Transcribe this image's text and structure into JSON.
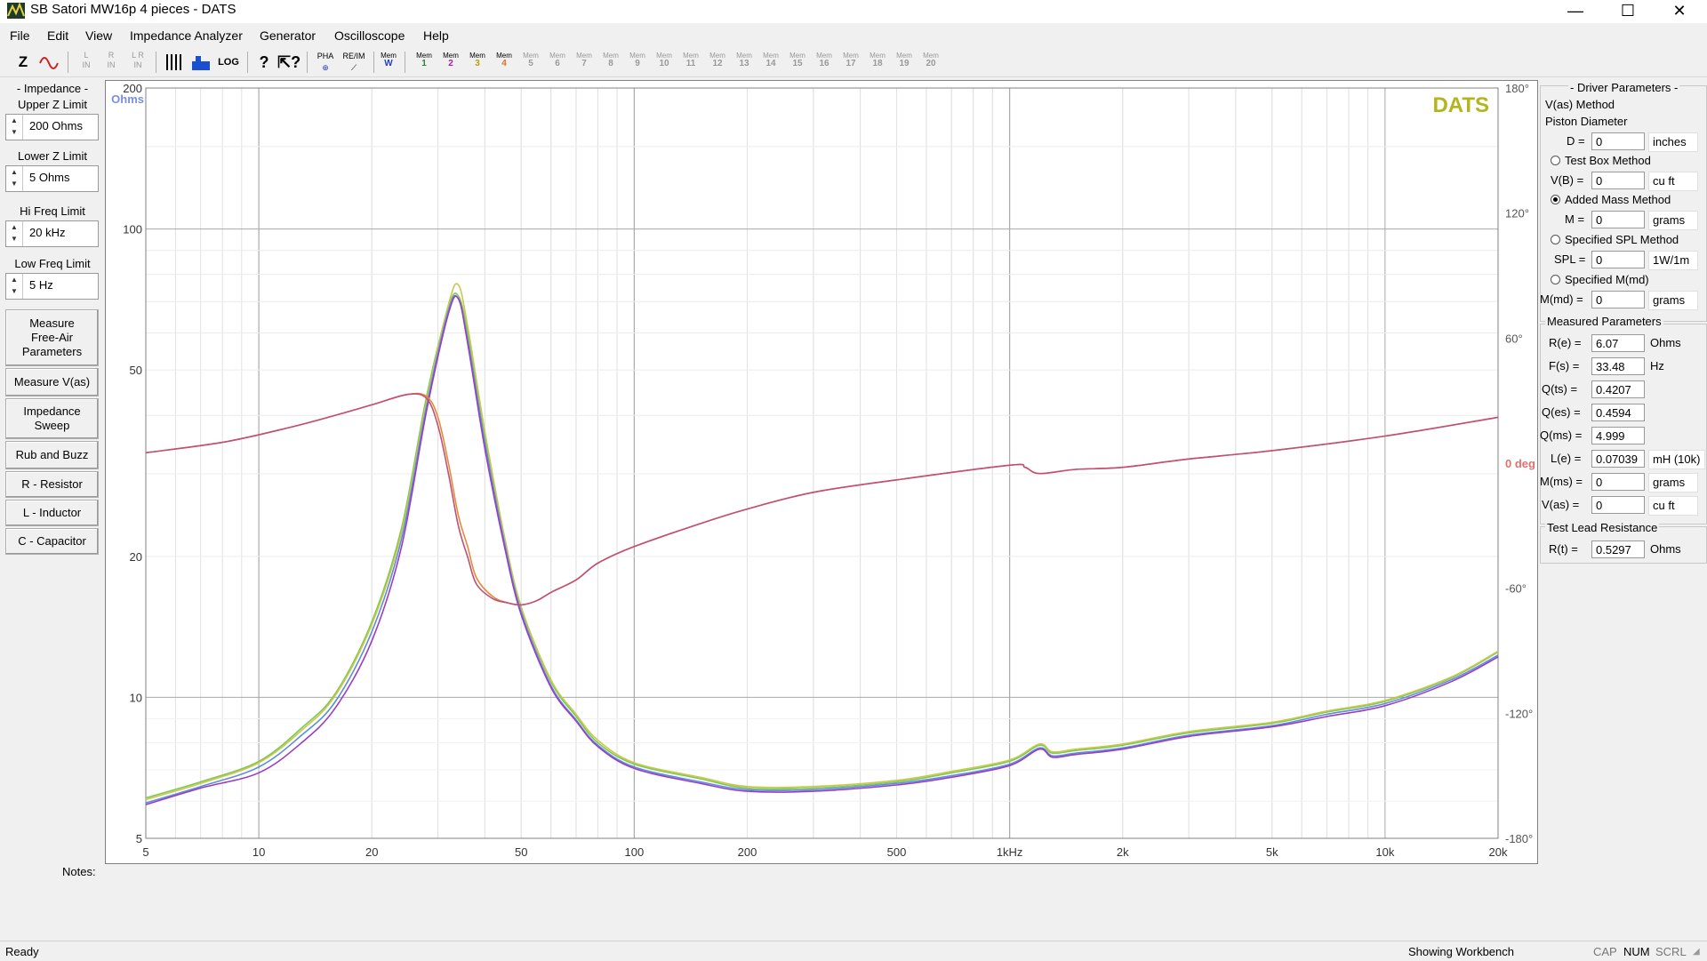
{
  "window": {
    "title": "SB Satori MW16p 4 pieces - DATS",
    "minimize": "—",
    "maximize": "☐",
    "close": "✕"
  },
  "menu": [
    "File",
    "Edit",
    "View",
    "Impedance Analyzer",
    "Generator",
    "Oscilloscope",
    "Help"
  ],
  "toolbar": {
    "z_label": "Z",
    "in_buttons": [
      {
        "a": "L",
        "b": "IN"
      },
      {
        "a": "R",
        "b": "IN"
      },
      {
        "a": "L R",
        "b": "IN"
      }
    ],
    "log_label": "LOG",
    "pha_label": "PHA",
    "reim_label": "RE/IM",
    "memw_label": "Mem",
    "memw_sub": "W",
    "mem_slots": [
      "1",
      "2",
      "3",
      "4",
      "5",
      "6",
      "7",
      "8",
      "9",
      "10",
      "11",
      "12",
      "13",
      "14",
      "15",
      "16",
      "17",
      "18",
      "19",
      "20"
    ],
    "mem_label": "Mem"
  },
  "left_panel": {
    "impedance_title": "- Impedance -",
    "upper_label": "Upper Z Limit",
    "upper_value": "200 Ohms",
    "lower_label": "Lower Z Limit",
    "lower_value": "5 Ohms",
    "hi_label": "Hi Freq Limit",
    "hi_value": "20 kHz",
    "low_label": "Low Freq Limit",
    "low_value": "5 Hz",
    "buttons": {
      "free_air": "Measure\nFree-Air\nParameters",
      "vas": "Measure V(as)",
      "sweep": "Impedance\nSweep",
      "rub": "Rub and Buzz",
      "r": "R - Resistor",
      "l": "L - Inductor",
      "c": "C - Capacitor"
    }
  },
  "plot": {
    "brand": "DATS",
    "unit_label": "Ohms",
    "left_ticks": [
      "200",
      "100",
      "50",
      "20",
      "10",
      "5"
    ],
    "right_ticks": [
      "180°",
      "120°",
      "60°",
      "0 deg",
      "-60°",
      "-120°",
      "-180°"
    ],
    "x_ticks": [
      "5",
      "10",
      "20",
      "50",
      "100",
      "200",
      "500",
      "1kHz",
      "2k",
      "5k",
      "10k",
      "20k"
    ],
    "colors": {
      "green": "#7ec850",
      "yellow": "#c8c850",
      "blue": "#5b8fd8",
      "purple": "#9a3cc8",
      "orange": "#e58a3a",
      "phase_pink": "#c05078",
      "brand": "#b4b41e",
      "deg": "#e07070"
    }
  },
  "chart_data": {
    "type": "line",
    "x_scale": "log",
    "xlim": [
      5,
      20000
    ],
    "ylim": [
      5,
      200
    ],
    "y_scale": "log",
    "y2lim": [
      -180,
      180
    ],
    "xlabel": "",
    "ylabel": "Ohms",
    "y2label": "deg",
    "series": [
      {
        "axis": "y",
        "color": "#7ec850",
        "x": [
          5,
          7,
          10,
          13,
          16,
          20,
          24,
          28,
          32,
          34,
          36,
          40,
          45,
          50,
          60,
          70,
          80,
          100,
          150,
          200,
          300,
          500,
          700,
          1000,
          1200,
          1300,
          1500,
          2000,
          3000,
          5000,
          7000,
          10000,
          15000,
          20000
        ],
        "y": [
          6.1,
          6.6,
          7.3,
          8.6,
          10.2,
          14.5,
          23,
          44,
          68,
          72,
          60,
          36,
          22,
          15.5,
          10.8,
          9.1,
          8.0,
          7.2,
          6.7,
          6.4,
          6.4,
          6.6,
          6.9,
          7.3,
          7.9,
          7.6,
          7.7,
          7.9,
          8.4,
          8.8,
          9.3,
          9.8,
          11.0,
          12.5
        ]
      },
      {
        "axis": "y",
        "color": "#c8c850",
        "x": [
          5,
          7,
          10,
          13,
          16,
          20,
          24,
          28,
          32,
          34,
          36,
          40,
          45,
          50,
          60,
          70,
          80,
          100,
          150,
          200,
          300,
          500,
          700,
          1000,
          1200,
          1300,
          1500,
          2000,
          3000,
          5000,
          7000,
          10000,
          15000,
          20000
        ],
        "y": [
          6.05,
          6.55,
          7.25,
          8.5,
          10.1,
          14.3,
          22.5,
          43,
          69,
          76,
          62,
          37,
          22.3,
          15.6,
          10.9,
          9.2,
          8.1,
          7.25,
          6.75,
          6.45,
          6.45,
          6.65,
          6.95,
          7.35,
          7.95,
          7.65,
          7.75,
          7.95,
          8.45,
          8.85,
          9.35,
          9.85,
          11.05,
          12.55
        ]
      },
      {
        "axis": "y",
        "color": "#5b8fd8",
        "x": [
          5,
          7,
          10,
          13,
          16,
          20,
          24,
          28,
          32,
          34,
          36,
          40,
          45,
          50,
          60,
          70,
          80,
          100,
          150,
          200,
          300,
          500,
          700,
          1000,
          1200,
          1300,
          1500,
          2000,
          3000,
          5000,
          7000,
          10000,
          15000,
          20000
        ],
        "y": [
          5.95,
          6.45,
          7.1,
          8.3,
          9.8,
          13.8,
          21.8,
          42,
          67,
          71,
          58,
          35,
          21.6,
          15.2,
          10.6,
          8.95,
          7.9,
          7.1,
          6.6,
          6.35,
          6.35,
          6.55,
          6.8,
          7.2,
          7.8,
          7.5,
          7.6,
          7.8,
          8.3,
          8.7,
          9.2,
          9.7,
          10.9,
          12.3
        ]
      },
      {
        "axis": "y",
        "color": "#9a3cc8",
        "x": [
          5,
          7,
          10,
          13,
          16,
          20,
          24,
          28,
          32,
          34,
          36,
          40,
          45,
          50,
          60,
          70,
          80,
          100,
          150,
          200,
          300,
          500,
          700,
          1000,
          1200,
          1300,
          1500,
          2000,
          3000,
          5000,
          7000,
          10000,
          15000,
          20000
        ],
        "y": [
          5.9,
          6.4,
          6.9,
          8.0,
          9.5,
          13.2,
          21,
          41,
          66,
          71,
          57,
          34,
          21.2,
          15.0,
          10.5,
          8.9,
          7.85,
          7.05,
          6.55,
          6.3,
          6.3,
          6.5,
          6.75,
          7.15,
          7.75,
          7.45,
          7.55,
          7.75,
          8.25,
          8.65,
          9.1,
          9.6,
          10.8,
          12.2
        ]
      },
      {
        "axis": "y2",
        "color": "#e58a3a",
        "x": [
          5,
          8,
          12,
          16,
          20,
          25,
          28,
          30,
          32,
          34,
          36,
          38,
          42,
          46,
          50,
          55,
          60,
          70,
          80,
          100,
          150,
          200,
          300,
          500,
          1000,
          1100,
          1200,
          1500,
          2000,
          3000,
          5000,
          10000,
          20000
        ],
        "y": [
          5,
          10,
          17,
          23,
          28,
          33,
          32,
          22,
          0,
          -25,
          -40,
          -55,
          -64,
          -67,
          -68,
          -66,
          -62,
          -56,
          -48,
          -40,
          -29,
          -22,
          -14,
          -8,
          -1,
          -2,
          -5,
          -3,
          -2,
          2,
          6,
          13,
          22
        ]
      },
      {
        "axis": "y2",
        "color": "#c05078",
        "x": [
          5,
          8,
          12,
          16,
          20,
          25,
          28,
          30,
          32,
          34,
          36,
          38,
          42,
          46,
          50,
          55,
          60,
          70,
          80,
          100,
          150,
          200,
          300,
          500,
          1000,
          1100,
          1200,
          1500,
          2000,
          3000,
          5000,
          10000,
          20000
        ],
        "y": [
          5,
          10,
          17,
          23,
          28,
          33,
          31,
          18,
          -5,
          -30,
          -45,
          -58,
          -65,
          -67,
          -68,
          -66,
          -62,
          -56,
          -48,
          -40,
          -29,
          -22,
          -14,
          -8,
          -1,
          -2,
          -5,
          -3,
          -2,
          2,
          6,
          13,
          22
        ]
      }
    ]
  },
  "right_panel": {
    "title": "- Driver Parameters -",
    "vas_method": "V(as) Method",
    "piston": "Piston Diameter",
    "d_label": "D =",
    "d_value": "0",
    "d_unit": "inches",
    "test_box": "Test Box Method",
    "vb_label": "V(B) =",
    "vb_value": "0",
    "vb_unit": "cu ft",
    "added_mass": "Added Mass Method",
    "m_label": "M =",
    "m_value": "0",
    "m_unit": "grams",
    "spl_method": "Specified SPL Method",
    "spl_label": "SPL =",
    "spl_value": "0",
    "spl_unit": "1W/1m",
    "mmd_method": "Specified M(md)",
    "mmd_label": "M(md) =",
    "mmd_value": "0",
    "mmd_unit": "grams",
    "measured_title": "Measured Parameters",
    "re_label": "R(e) =",
    "re_value": "6.07",
    "re_unit": "Ohms",
    "fs_label": "F(s) =",
    "fs_value": "33.48",
    "fs_unit": "Hz",
    "qts_label": "Q(ts) =",
    "qts_value": "0.4207",
    "qes_label": "Q(es) =",
    "qes_value": "0.4594",
    "qms_label": "Q(ms) =",
    "qms_value": "4.999",
    "le_label": "L(e) =",
    "le_value": "0.07039",
    "le_unit": "mH (10k)",
    "mms_label": "M(ms) =",
    "mms_value": "0",
    "mms_unit": "grams",
    "vas_label": "V(as) =",
    "vas_value": "0",
    "vas_unit": "cu ft",
    "lead_title": "Test Lead Resistance",
    "rt_label": "R(t) =",
    "rt_value": "0.5297",
    "rt_unit": "Ohms"
  },
  "notes_label": "Notes:",
  "status": {
    "left": "Ready",
    "workbench": "Showing Workbench",
    "cap": "CAP",
    "num": "NUM",
    "scrl": "SCRL"
  }
}
